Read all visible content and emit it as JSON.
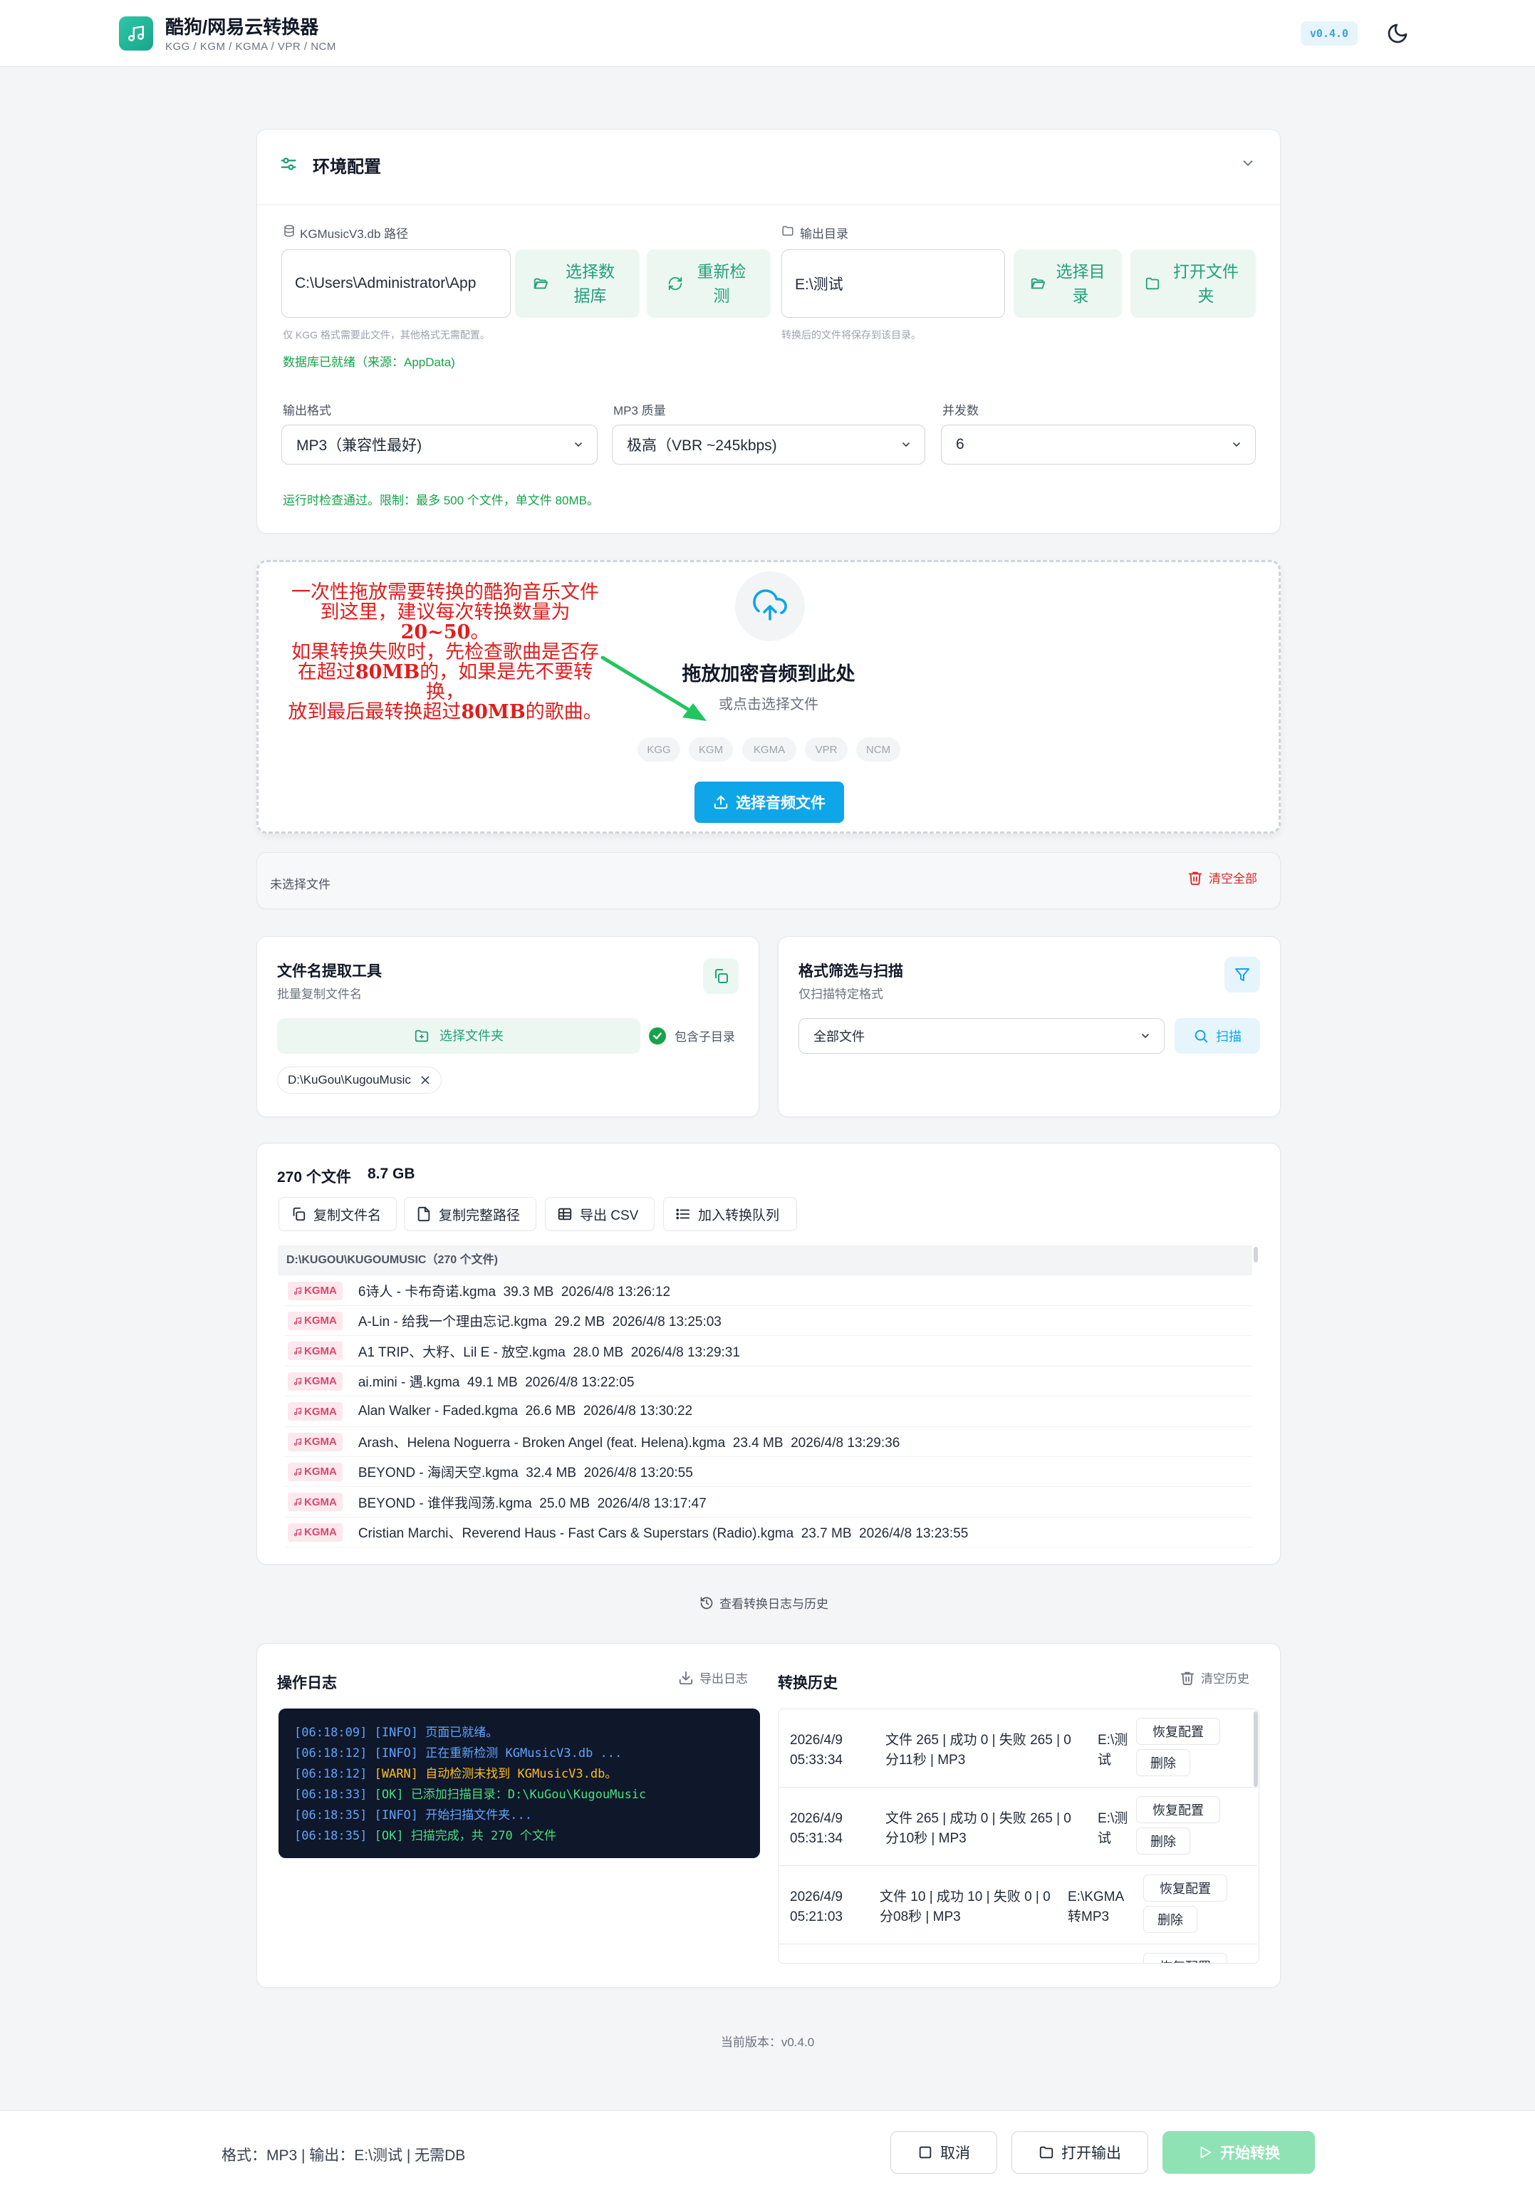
{
  "header": {
    "title": "酷狗/网易云转换器",
    "subtitle": "KGG / KGM / KGMA / VPR / NCM",
    "version_badge": "v0.4.0"
  },
  "env": {
    "title": "环境配置",
    "db_label": "KGMusicV3.db 路径",
    "db_value": "C:\\Users\\Administrator\\App",
    "db_select_btn": "选择数据库",
    "db_recheck_btn": "重新检测",
    "db_hint": "仅 KGG 格式需要此文件，其他格式无需配置。",
    "db_status": "数据库已就绪（来源：AppData)",
    "out_label": "输出目录",
    "out_value": "E:\\测试",
    "out_select_btn": "选择目录",
    "out_open_btn": "打开文件夹",
    "out_hint": "转换后的文件将保存到该目录。",
    "format_label": "输出格式",
    "format_value": "MP3（兼容性最好)",
    "quality_label": "MP3 质量",
    "quality_value": "极高（VBR ~245kbps)",
    "concurrency_label": "并发数",
    "concurrency_value": "6",
    "runtime_ok": "运行时检查通过。限制：最多 500 个文件，单文件 80MB。"
  },
  "drop": {
    "title": "拖放加密音频到此处",
    "subtitle": "或点击选择文件",
    "chips": [
      "KGG",
      "KGM",
      "KGMA",
      "VPR",
      "NCM"
    ],
    "button": "选择音频文件",
    "annotation": [
      "一次性拖放需要转换的酷狗音乐文件",
      "到这里，建议每次转换数量为",
      "20~50",
      "。",
      "如果转换失败时，先检查歌曲是否存",
      "在超过",
      "80MB",
      "的，如果是先不要转换，",
      "放到最后最转换超过",
      "80MB",
      "的歌曲。"
    ]
  },
  "selection": {
    "empty_text": "未选择文件",
    "clear_all": "清空全部"
  },
  "extract": {
    "title": "文件名提取工具",
    "subtitle": "批量复制文件名",
    "select_folder": "选择文件夹",
    "include_sub": "包含子目录",
    "folder_tag": "D:\\KuGou\\KugouMusic"
  },
  "filter": {
    "title": "格式筛选与扫描",
    "subtitle": "仅扫描特定格式",
    "select_value": "全部文件",
    "scan_btn": "扫描"
  },
  "results": {
    "count": "270 个文件",
    "size": "8.7 GB",
    "actions": [
      "复制文件名",
      "复制完整路径",
      "导出 CSV",
      "加入转换队列"
    ],
    "group_header": "D:\\KUGOU\\KUGOUMUSIC（270 个文件)",
    "tag": "KGMA",
    "rows": [
      "6诗人 - 卡布奇诺.kgma  39.3 MB  2026/4/8 13:26:12",
      "A-Lin - 给我一个理由忘记.kgma  29.2 MB  2026/4/8 13:25:03",
      "A1 TRIP、大籽、Lil E - 放空.kgma  28.0 MB  2026/4/8 13:29:31",
      "ai.mini - 遇.kgma  49.1 MB  2026/4/8 13:22:05",
      "Alan Walker - Faded.kgma  26.6 MB  2026/4/8 13:30:22",
      "Arash、Helena Noguerra - Broken Angel (feat. Helena).kgma  23.4 MB  2026/4/8 13:29:36",
      "BEYOND - 海阔天空.kgma  32.4 MB  2026/4/8 13:20:55",
      "BEYOND - 谁伴我闯荡.kgma  25.0 MB  2026/4/8 13:17:47",
      "Cristian Marchi、Reverend Haus - Fast Cars & Superstars (Radio).kgma  23.7 MB  2026/4/8 13:23:55"
    ]
  },
  "log_link": "查看转换日志与历史",
  "oplog": {
    "title": "操作日志",
    "export": "导出日志",
    "lines": [
      {
        "ts": "[06:18:09]",
        "lvl": "[INFO]",
        "msg": "页面已就绪。"
      },
      {
        "ts": "[06:18:12]",
        "lvl": "[INFO]",
        "msg": "正在重新检测 KGMusicV3.db ..."
      },
      {
        "ts": "[06:18:12]",
        "lvl": "[WARN]",
        "msg": "自动检测未找到 KGMusicV3.db。"
      },
      {
        "ts": "[06:18:33]",
        "lvl": "[OK]",
        "msg": "已添加扫描目录：D:\\KuGou\\KugouMusic"
      },
      {
        "ts": "[06:18:35]",
        "lvl": "[INFO]",
        "msg": "开始扫描文件夹..."
      },
      {
        "ts": "[06:18:35]",
        "lvl": "[OK]",
        "msg": "扫描完成，共 270 个文件"
      }
    ],
    "colors": {
      "INFO": "#60a5fa",
      "WARN": "#fbbf24",
      "OK": "#4ade80",
      "ts": "#60a5fa"
    }
  },
  "history": {
    "title": "转换历史",
    "clear": "清空历史",
    "restore": "恢复配置",
    "delete": "删除",
    "rows": [
      {
        "date": "2026/4/9",
        "time": "05:33:34",
        "stats1": "文件 265 | 成功 0 | 失败 265 | 0",
        "stats2": "分11秒 | MP3",
        "out1": "E:\\测",
        "out2": "试"
      },
      {
        "date": "2026/4/9",
        "time": "05:31:34",
        "stats1": "文件 265 | 成功 0 | 失败 265 | 0",
        "stats2": "分10秒 | MP3",
        "out1": "E:\\测",
        "out2": "试"
      },
      {
        "date": "2026/4/9",
        "time": "05:21:03",
        "stats1": "文件 10 | 成功 10 | 失败 0 | 0",
        "stats2": "分08秒 | MP3",
        "out1": "E:\\KGMA",
        "out2": "转MP3"
      }
    ],
    "partial_btn": "恢复配置"
  },
  "version_line": "当前版本：v0.4.0",
  "footer": {
    "status": "格式：MP3 | 输出：E:\\测试 | 无需DB",
    "cancel": "取消",
    "open_output": "打开输出",
    "start": "开始转换"
  },
  "colors": {
    "accent": "#22a07b",
    "primary_blue": "#0ea5e9",
    "danger": "#dc2626",
    "ok": "#16a34a"
  }
}
